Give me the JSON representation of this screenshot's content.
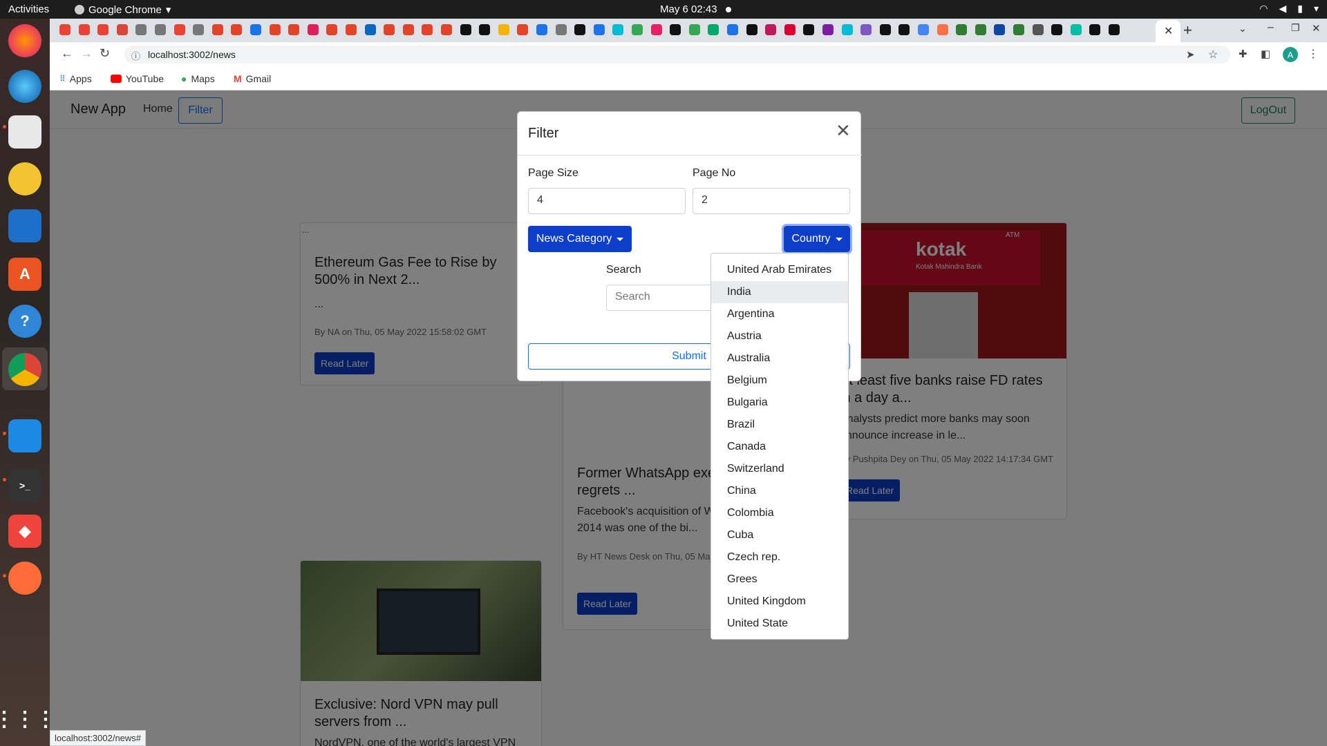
{
  "topbar": {
    "activities": "Activities",
    "app": "Google Chrome",
    "clock": "May 6  02:43"
  },
  "browser": {
    "url": "localhost:3002/news",
    "bookmarks": [
      {
        "label": "Apps",
        "icon": "apps-grid-icon"
      },
      {
        "label": "YouTube",
        "icon": "youtube-icon"
      },
      {
        "label": "Maps",
        "icon": "maps-pin-icon"
      },
      {
        "label": "Gmail",
        "icon": "gmail-icon"
      }
    ],
    "status_url": "localhost:3002/news#",
    "avatar_letter": "A"
  },
  "navbar": {
    "brand": "New App",
    "home": "Home",
    "filter": "Filter",
    "logout": "LogOut"
  },
  "cards": [
    {
      "img_alt": "...",
      "title": "Ethereum Gas Fee to Rise by 500% in Next 2...",
      "text": "...",
      "meta": "By NA on Thu, 05 May 2022 15:58:02 GMT",
      "button": "Read Later"
    },
    {
      "title": "Former WhatsApp exec says he regrets ...",
      "text": "Facebook's acquisition of WhatsApp in 2014 was one of the bi...",
      "meta": "By HT News Desk on Thu, 05 May 2022 GMT",
      "button": "Read Later"
    },
    {
      "title": "At least five banks raise FD rates in a day a...",
      "text": "Analysts predict more banks may soon announce increase in le...",
      "meta": "By Pushpita Dey on Thu, 05 May 2022 14:17:34 GMT",
      "button": "Read Later",
      "image_sign": "kotak",
      "image_sign_sub": "Kotak Mahindra Bank",
      "image_atm": "ATM"
    },
    {
      "title": "Exclusive: Nord VPN may pull servers from ...",
      "text": "NordVPN, one of the world's largest VPN"
    }
  ],
  "modal": {
    "title": "Filter",
    "page_size_label": "Page Size",
    "page_size_value": "4",
    "page_no_label": "Page No",
    "page_no_value": "2",
    "category_button": "News Category",
    "country_button": "Country",
    "search_label": "Search",
    "search_placeholder": "Search",
    "submit": "Submit"
  },
  "dropdown": {
    "items": [
      "United Arab Emirates",
      "India",
      "Argentina",
      "Austria",
      "Australia",
      "Belgium",
      "Bulgaria",
      "Brazil",
      "Canada",
      "Switzerland",
      "China",
      "Colombia",
      "Cuba",
      "Czech rep.",
      "Grees",
      "United Kingdom",
      "United State"
    ],
    "hovered": "India"
  },
  "colors": {
    "primary": "#0d3ec9",
    "outline_blue": "#0d6efd",
    "logout_green": "#198754"
  }
}
